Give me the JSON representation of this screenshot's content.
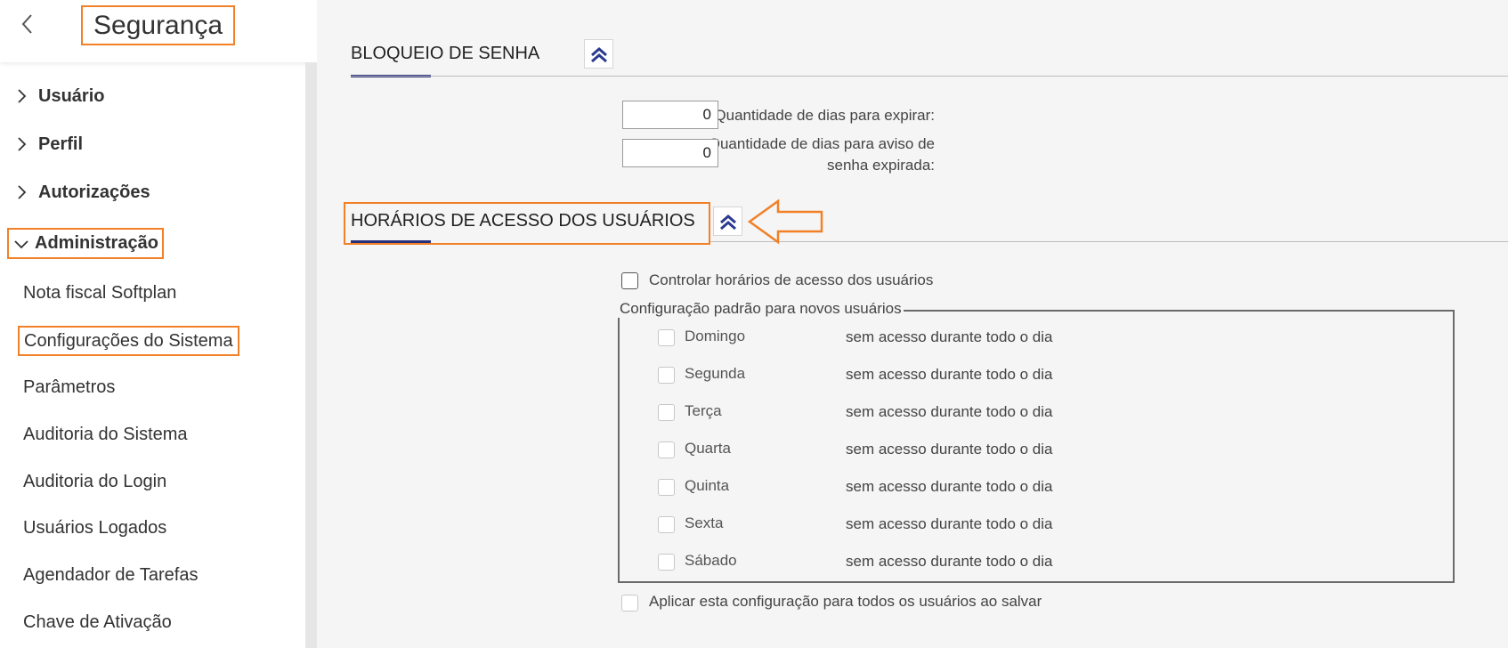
{
  "sidebar": {
    "title": "Segurança",
    "groups": [
      {
        "label": "Usuário",
        "expanded": false
      },
      {
        "label": "Perfil",
        "expanded": false
      },
      {
        "label": "Autorizações",
        "expanded": false
      },
      {
        "label": "Administração",
        "expanded": true
      }
    ],
    "admin_items": [
      "Nota fiscal Softplan",
      "Configurações do Sistema",
      "Parâmetros",
      "Auditoria do Sistema",
      "Auditoria do Login",
      "Usuários Logados",
      "Agendador de Tarefas",
      "Chave de Ativação"
    ]
  },
  "password_lock": {
    "title": "BLOQUEIO DE SENHA",
    "days_to_expire_label": "Quantidade de dias para expirar:",
    "days_to_expire_value": "0",
    "days_warning_label_line1": "Quantidade de dias para aviso de",
    "days_warning_label_line2": "senha expirada:",
    "days_warning_value": "0"
  },
  "access_hours": {
    "title": "HORÁRIOS DE ACESSO DOS USUÁRIOS",
    "control_label": "Controlar horários de acesso dos usuários",
    "control_checked": false,
    "default_config_legend": "Configuração padrão para novos usuários",
    "days": [
      {
        "name": "Domingo",
        "status": "sem acesso durante todo o dia"
      },
      {
        "name": "Segunda",
        "status": "sem acesso durante todo o dia"
      },
      {
        "name": "Terça",
        "status": "sem acesso durante todo o dia"
      },
      {
        "name": "Quarta",
        "status": "sem acesso durante todo o dia"
      },
      {
        "name": "Quinta",
        "status": "sem acesso durante todo o dia"
      },
      {
        "name": "Sexta",
        "status": "sem acesso durante todo o dia"
      },
      {
        "name": "Sábado",
        "status": "sem acesso durante todo o dia"
      }
    ],
    "apply_all_label": "Aplicar esta configuração para todos os usuários ao salvar"
  },
  "icons": {
    "back": "chevron-left-icon",
    "collapsed": "chevron-right-icon",
    "expanded": "chevron-down-icon",
    "collapse_section": "double-chevron-up-icon",
    "annotation": "arrow-left-icon"
  },
  "colors": {
    "highlight": "#f28027",
    "accent": "#2a2f7a"
  }
}
